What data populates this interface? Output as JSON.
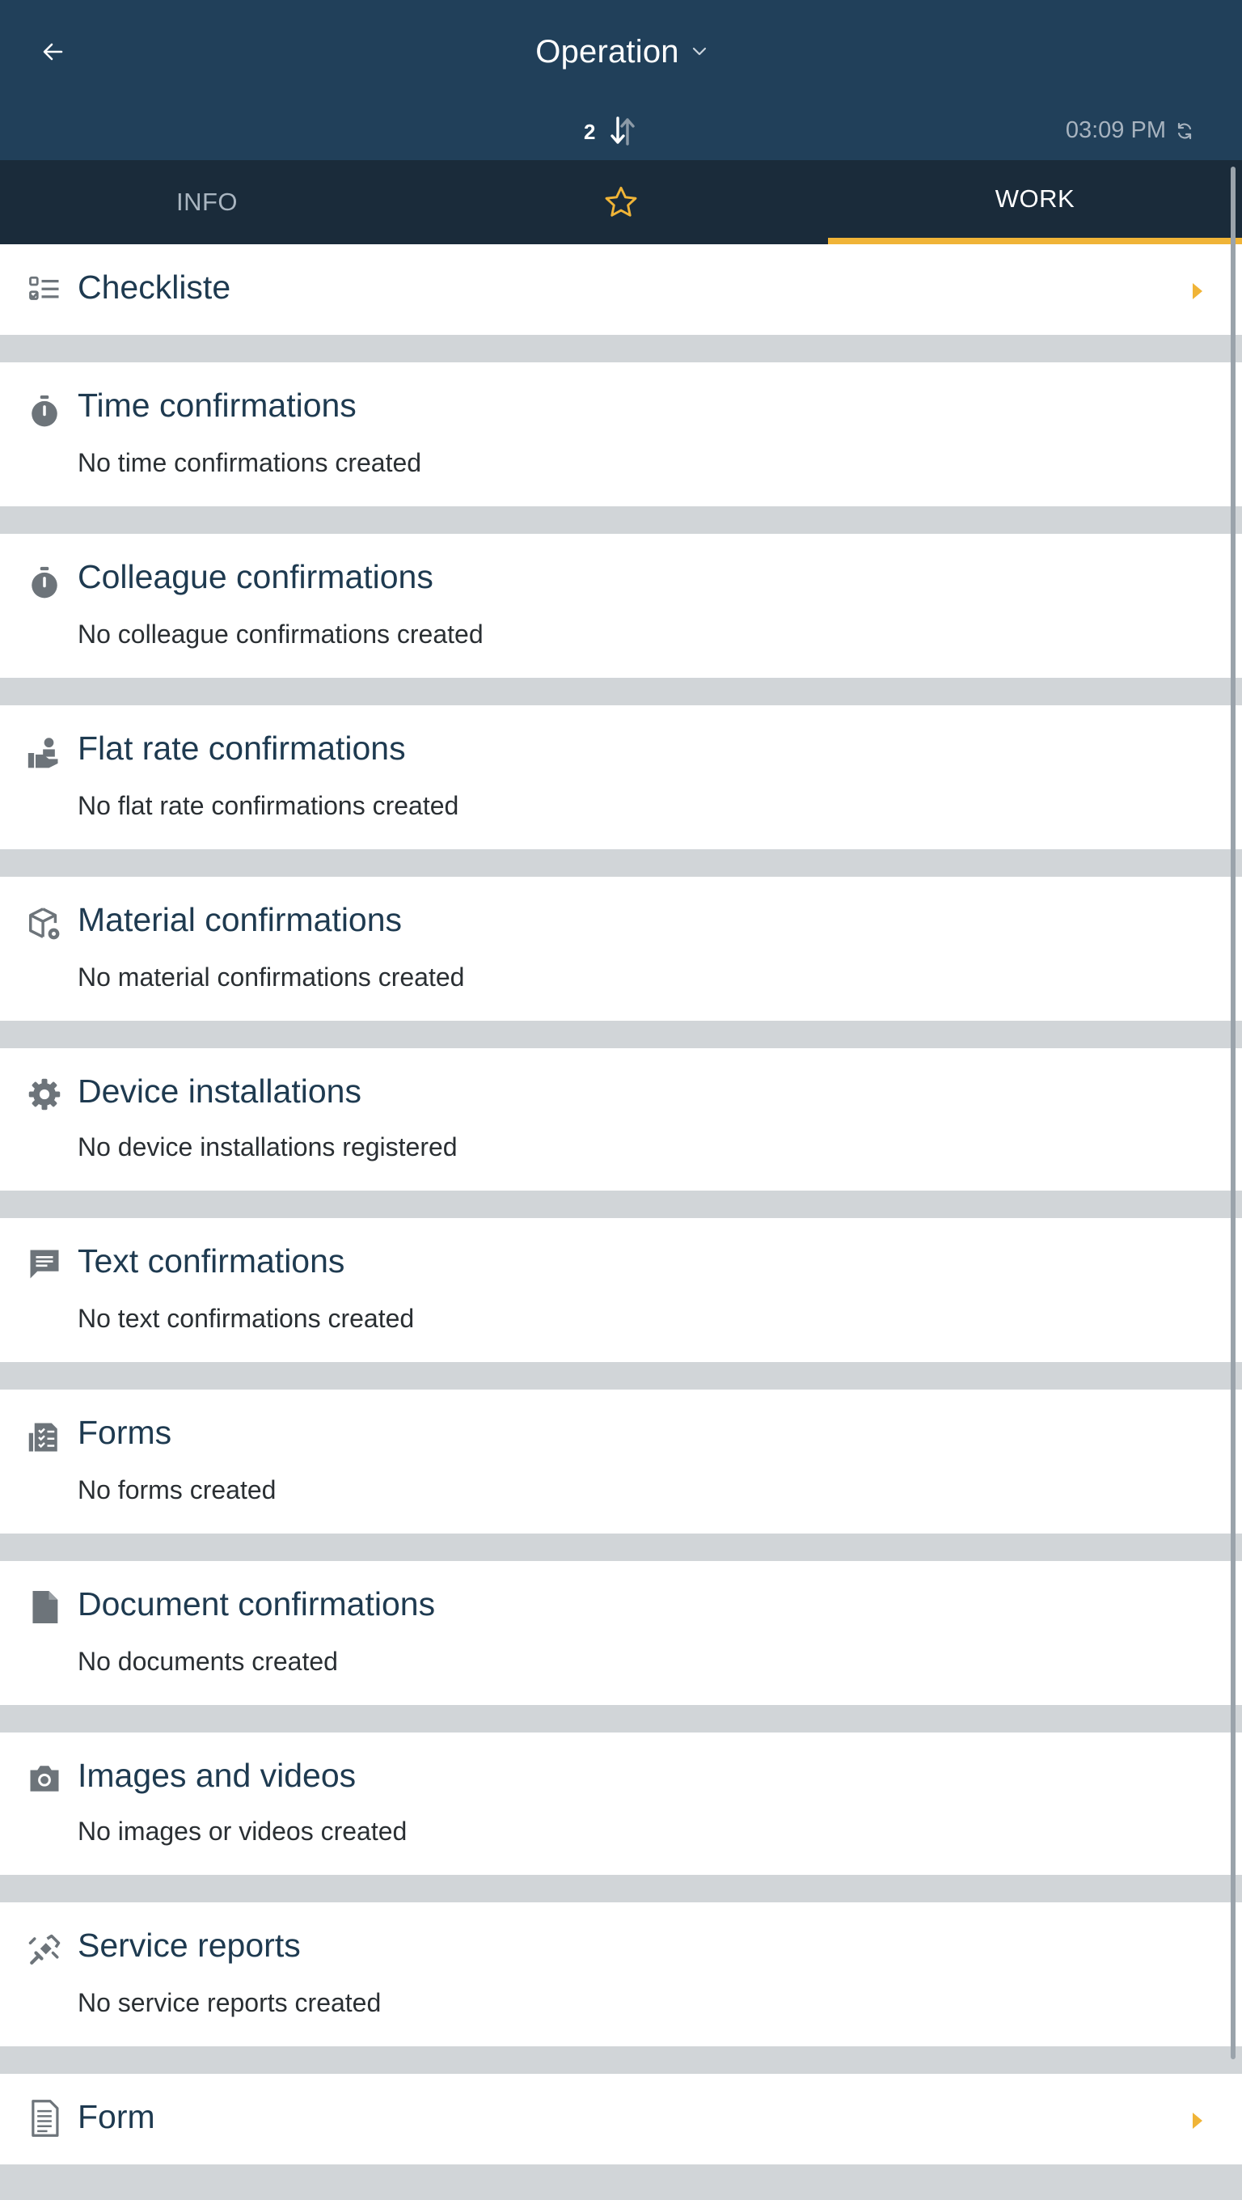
{
  "header": {
    "back_icon": "arrow-left-icon",
    "title": "Operation",
    "title_caret_icon": "chevron-down-icon",
    "sync_count": "2",
    "sync_icon": "sync-arrows-icon",
    "time": "03:09 PM",
    "refresh_icon": "refresh-icon"
  },
  "tabs": {
    "info": "INFO",
    "favorites_icon": "star-outline-icon",
    "work": "WORK",
    "active": "work"
  },
  "colors": {
    "header_bg": "#21405a",
    "tabbar_bg": "#1a2b3a",
    "accent": "#f0b437",
    "heading_text": "#1e3a50",
    "separator": "#d1d5d8"
  },
  "sections": [
    {
      "title": "Checkliste",
      "subtitle": "",
      "icon": "checklist-icon",
      "has_chevron": true
    },
    {
      "title": "Time confirmations",
      "subtitle": "No time confirmations created",
      "icon": "stopwatch-icon"
    },
    {
      "title": "Colleague confirmations",
      "subtitle": "No colleague confirmations created",
      "icon": "stopwatch-icon"
    },
    {
      "title": "Flat rate confirmations",
      "subtitle": "No flat rate confirmations created",
      "icon": "hand-person-icon"
    },
    {
      "title": "Material confirmations",
      "subtitle": "No material confirmations created",
      "icon": "box-gear-icon"
    },
    {
      "title": "Device installations",
      "subtitle": "No device installations registered",
      "icon": "gear-icon"
    },
    {
      "title": "Text confirmations",
      "subtitle": "No text confirmations created",
      "icon": "comment-icon"
    },
    {
      "title": "Forms",
      "subtitle": "No forms created",
      "icon": "form-checklist-icon"
    },
    {
      "title": "Document confirmations",
      "subtitle": "No documents created",
      "icon": "document-icon"
    },
    {
      "title": "Images and videos",
      "subtitle": "No images or videos created",
      "icon": "camera-icon"
    },
    {
      "title": "Service reports",
      "subtitle": "No service reports created",
      "icon": "service-report-icon"
    },
    {
      "title": "Form",
      "subtitle": "",
      "icon": "form-document-icon",
      "has_chevron": true
    }
  ]
}
